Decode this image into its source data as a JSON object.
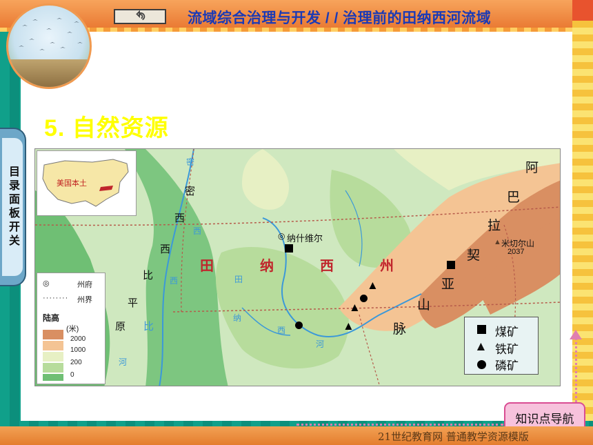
{
  "header": {
    "title": "流域综合治理与开发 / / 治理前的田纳西河流域",
    "back_icon": "undo-arrow-icon"
  },
  "section": {
    "title": "5.   自然资源"
  },
  "side_panel": {
    "label": "目录面板开关"
  },
  "map": {
    "inset_label": "美国本土",
    "state_label": [
      "田",
      "纳",
      "西",
      "州"
    ],
    "range_label": [
      "阿",
      "巴",
      "拉",
      "契",
      "亚",
      "山",
      "脉"
    ],
    "plain_label": [
      "密",
      "西",
      "西",
      "比",
      "平",
      "原"
    ],
    "city": "纳什维尔",
    "peak_name": "米切尔山",
    "peak_height": "2037",
    "river_labels": [
      "密",
      "西",
      "西",
      "比",
      "河",
      "田",
      "纳",
      "西",
      "河"
    ]
  },
  "legend": {
    "capital": "州府",
    "boundary": "州界",
    "elevation_title": "陆高",
    "unit": "(米)",
    "levels": [
      "2000",
      "1000",
      "200",
      "0"
    ],
    "colors": [
      "#d98f62",
      "#f4c494",
      "#e7f0c4",
      "#b7dc9c",
      "#6fbf74"
    ]
  },
  "minerals": {
    "coal": "煤矿",
    "iron": "铁矿",
    "phosphate": "磷矿"
  },
  "nav": {
    "label": "知识点导航"
  },
  "footer": {
    "text": "21世纪教育网   普通教学资源模版"
  }
}
